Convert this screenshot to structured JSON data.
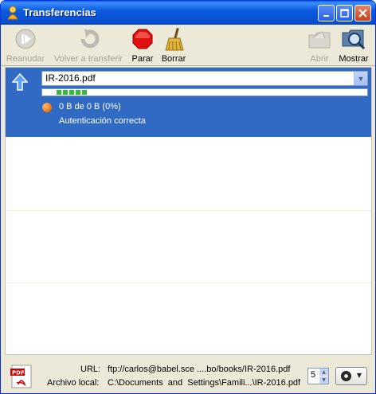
{
  "window": {
    "title": "Transferencias"
  },
  "toolbar": {
    "resume_label": "Reanudar",
    "retry_label": "Volver a transferir",
    "stop_label": "Parar",
    "clear_label": "Borrar",
    "open_label": "Abrir",
    "show_label": "Mostrar"
  },
  "transfer": {
    "file_name": "IR-2016.pdf",
    "progress_text": "0 B de 0 B (0%)",
    "progress_percent": 0,
    "status_text": "Autenticación correcta"
  },
  "details": {
    "url_label": "URL:",
    "url_value": "ftp://carlos@babel.sce ....bo/books/IR-2016.pdf",
    "local_label": "Archivo local:",
    "local_value": "C:\\Documents  and  Settings\\Famili...\\IR-2016.pdf",
    "connections_value": "5"
  },
  "colors": {
    "selection": "#316ac5",
    "title_bar": "#0a4fd0"
  }
}
